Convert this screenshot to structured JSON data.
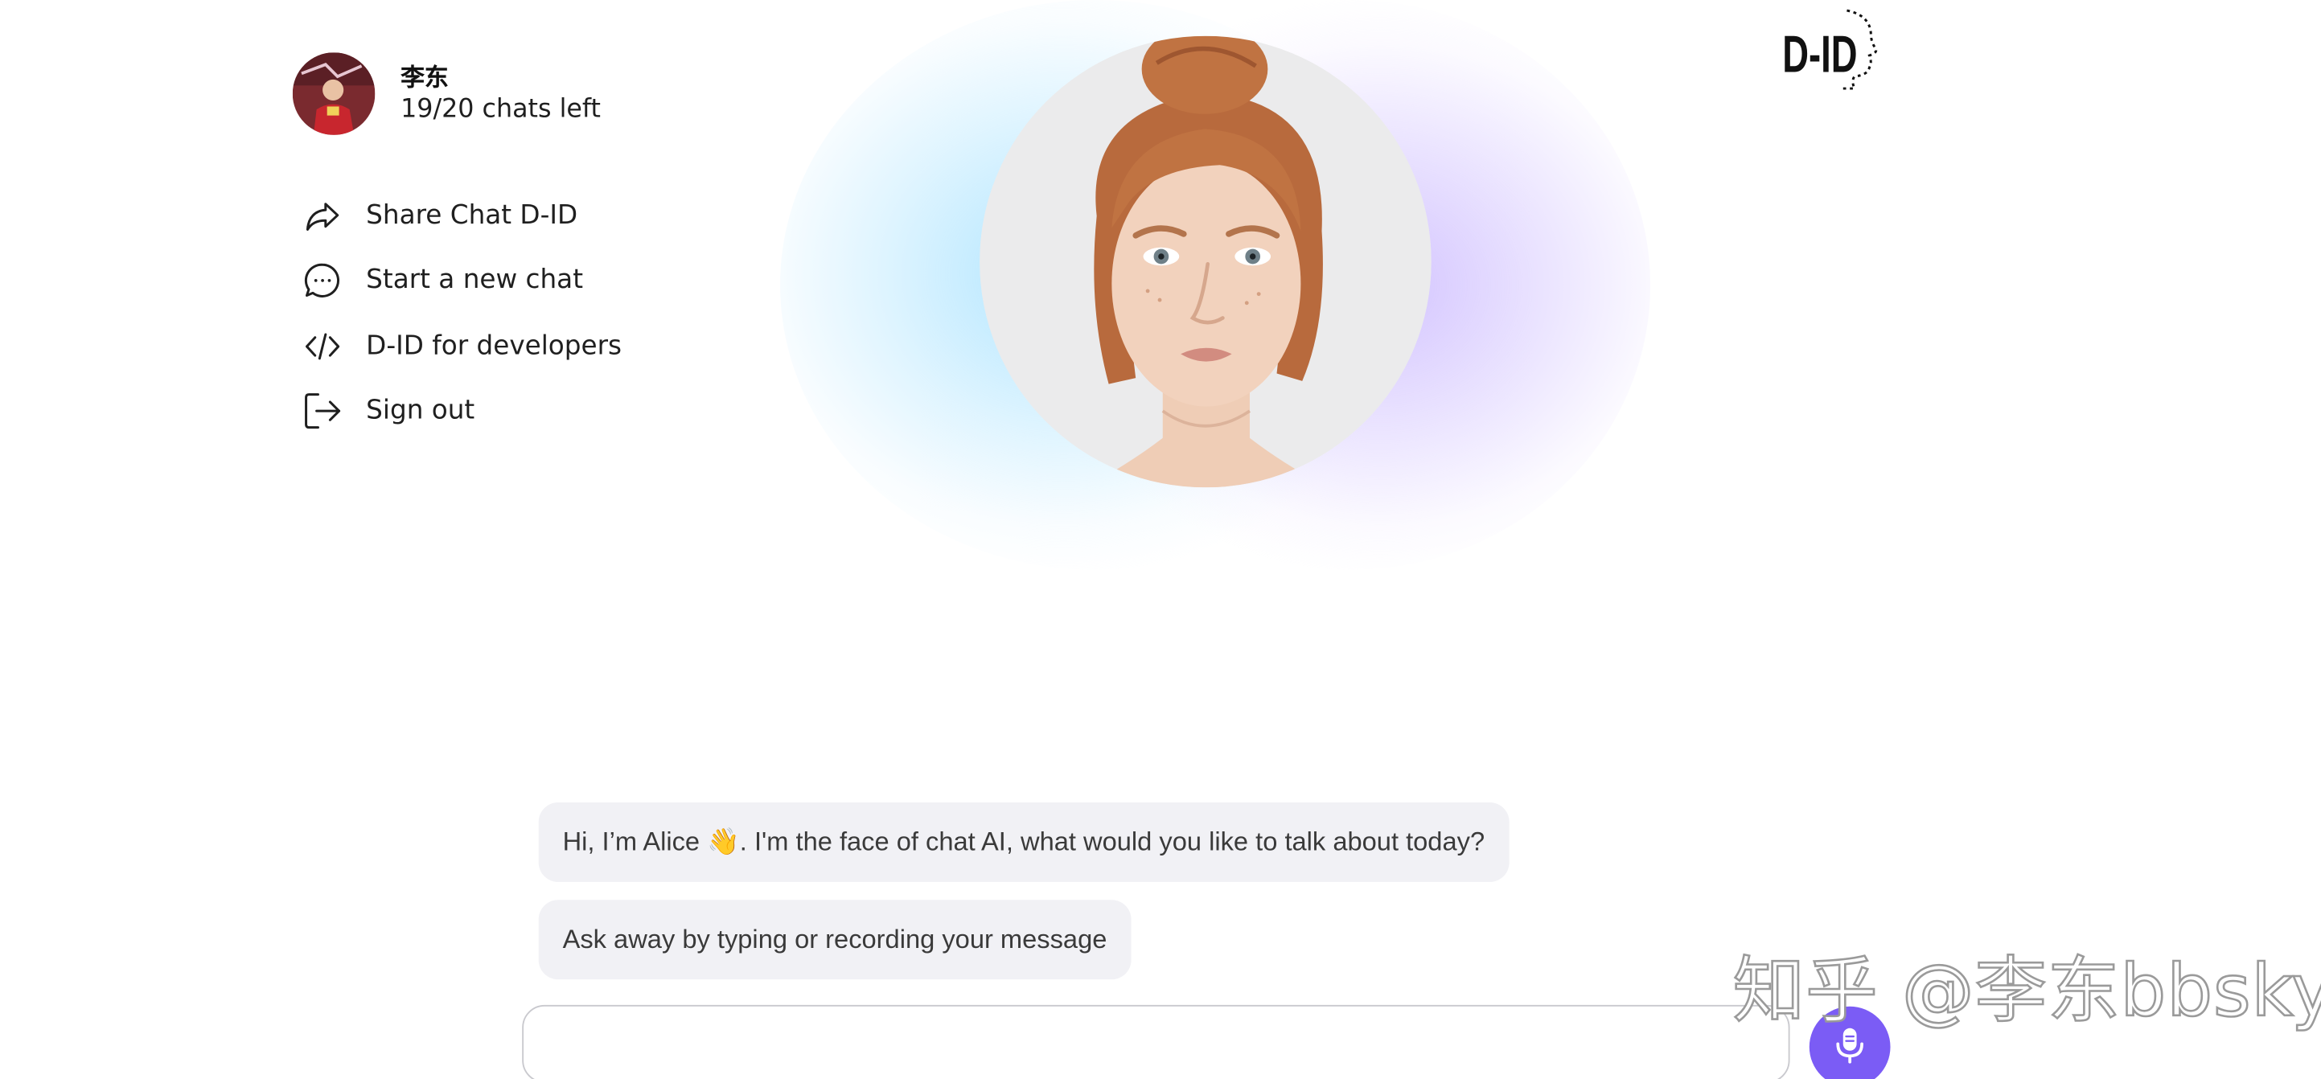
{
  "user": {
    "name": "李东",
    "credits_text": "19/20 chats left",
    "avatar_icon": "user-avatar-photo"
  },
  "menu": {
    "items": [
      {
        "label": "Share Chat D-ID",
        "icon": "share-icon"
      },
      {
        "label": "Start a new chat",
        "icon": "chat-bubble-icon"
      },
      {
        "label": "D-ID for developers",
        "icon": "code-icon"
      },
      {
        "label": "Sign out",
        "icon": "sign-out-icon"
      }
    ]
  },
  "hero": {
    "portrait_icon": "avatar-portrait-alice"
  },
  "logo": {
    "text": "D-ID"
  },
  "chat": {
    "messages": [
      {
        "text": "Hi, I’m Alice 👋. I'm the face of chat AI, what would you like to talk about today?"
      },
      {
        "text": "Ask away by typing or recording your message"
      }
    ],
    "input": {
      "value": "",
      "placeholder": ""
    },
    "mic_icon": "microphone-icon"
  },
  "watermark": {
    "text": "知乎 @李东bbsky"
  },
  "colors": {
    "accent": "#7b5cf5",
    "bubble_bg": "#f1f1f5",
    "glow_blue": "#b9e6ff",
    "glow_purple": "#d4c6ff"
  }
}
